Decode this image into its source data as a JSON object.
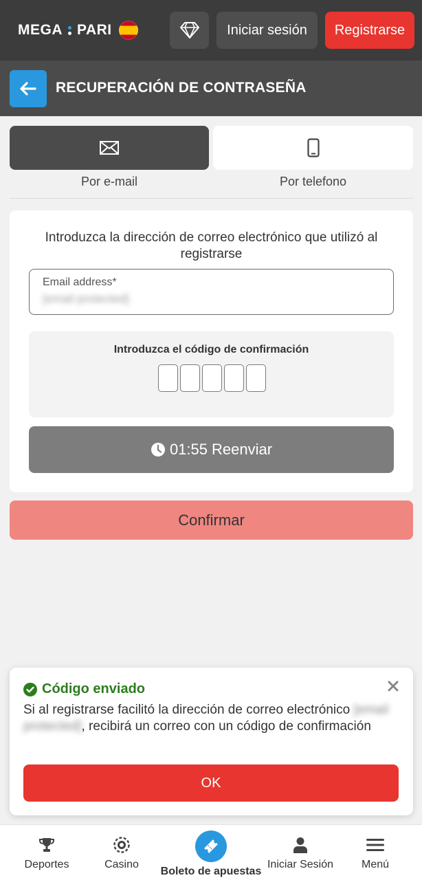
{
  "header": {
    "logo_left": "MEGA",
    "logo_right": "PARI",
    "login_label": "Iniciar sesión",
    "register_label": "Registrarse",
    "icons": {
      "diamond": "diamond-icon",
      "flag": "spain-flag-icon"
    }
  },
  "titlebar": {
    "title": "RECUPERACIÓN DE CONTRASEÑA",
    "back_icon": "arrow-left-icon"
  },
  "tabs": [
    {
      "label": "Por e-mail",
      "icon": "envelope-icon",
      "active": true
    },
    {
      "label": "Por telefono",
      "icon": "smartphone-icon",
      "active": false
    }
  ],
  "form": {
    "instruction": "Introduzca la dirección de correo electrónico que utilizó al registrarse",
    "email_label": "Email address*",
    "email_value": "[email protected]",
    "code_title": "Introduzca el código de confirmación",
    "code_cells": 5,
    "timer": "01:55",
    "resend_label": "Reenviar",
    "confirm_label": "Confirmar"
  },
  "toast": {
    "title": "Código enviado",
    "text_before": "Si al registrarse facilitó la dirección de correo electrónico",
    "email_masked": "[email protected]",
    "text_after": ", recibirá un correo con un código de confirmación",
    "ok_label": "OK"
  },
  "bottom_nav": [
    {
      "label": "Deportes",
      "icon": "trophy-icon"
    },
    {
      "label": "Casino",
      "icon": "casino-chip-icon"
    },
    {
      "label": "Boleto de apuestas",
      "icon": "ticket-icon"
    },
    {
      "label": "Iniciar Sesión",
      "icon": "user-icon"
    },
    {
      "label": "Menú",
      "icon": "hamburger-menu-icon"
    }
  ],
  "colors": {
    "header_bg": "#3c3c3c",
    "titlebar_bg": "#4b4b4b",
    "accent_blue": "#2a98de",
    "accent_red": "#e8352f",
    "confirm_disabled": "#ef8680",
    "success_green": "#2d7d1f"
  }
}
